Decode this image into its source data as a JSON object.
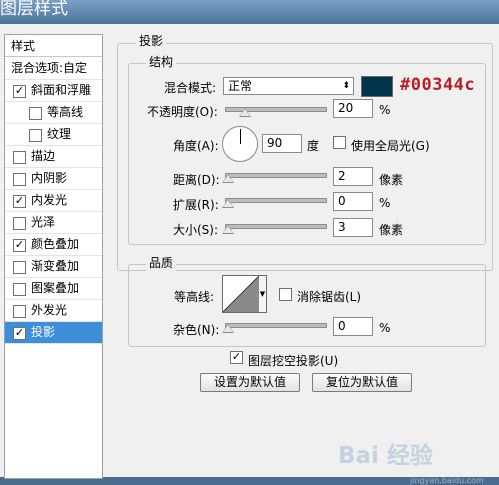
{
  "window": {
    "title": "图层样式"
  },
  "style_list": {
    "header": "样式",
    "blend_options": "混合选项:自定",
    "items": [
      {
        "label": "斜面和浮雕",
        "checked": "✓"
      },
      {
        "label": "等高线",
        "checked": ""
      },
      {
        "label": "纹理",
        "checked": ""
      },
      {
        "label": "描边",
        "checked": ""
      },
      {
        "label": "内阴影",
        "checked": ""
      },
      {
        "label": "内发光",
        "checked": "✓"
      },
      {
        "label": "光泽",
        "checked": ""
      },
      {
        "label": "颜色叠加",
        "checked": "✓"
      },
      {
        "label": "渐变叠加",
        "checked": ""
      },
      {
        "label": "图案叠加",
        "checked": ""
      },
      {
        "label": "外发光",
        "checked": ""
      },
      {
        "label": "投影",
        "checked": "✓"
      }
    ]
  },
  "panel": {
    "section_title": "投影",
    "structure": {
      "legend": "结构",
      "blend_mode_label": "混合模式:",
      "blend_mode_value": "正常",
      "shadow_color": "#00344c",
      "color_annotation": "#00344c",
      "opacity_label": "不透明度(O):",
      "opacity_value": "20",
      "opacity_unit": "%",
      "opacity_fraction": 0.2,
      "angle_label": "角度(A):",
      "angle_value": "90",
      "angle_unit": "度",
      "global_light_label": "使用全局光(G)",
      "global_light_checked": "",
      "distance_label": "距离(D):",
      "distance_value": "2",
      "distance_unit": "像素",
      "spread_label": "扩展(R):",
      "spread_value": "0",
      "spread_unit": "%",
      "size_label": "大小(S):",
      "size_value": "3",
      "size_unit": "像素"
    },
    "quality": {
      "legend": "品质",
      "contour_label": "等高线:",
      "antialias_label": "消除锯齿(L)",
      "antialias_checked": "",
      "noise_label": "杂色(N):",
      "noise_value": "0",
      "noise_unit": "%"
    },
    "knockout_label": "图层挖空投影(U)",
    "knockout_checked": "✓",
    "btn_default": "设置为默认值",
    "btn_reset": "复位为默认值"
  },
  "watermark": {
    "main": "Bai 经验",
    "sub": "jingyan.baidu.com"
  }
}
